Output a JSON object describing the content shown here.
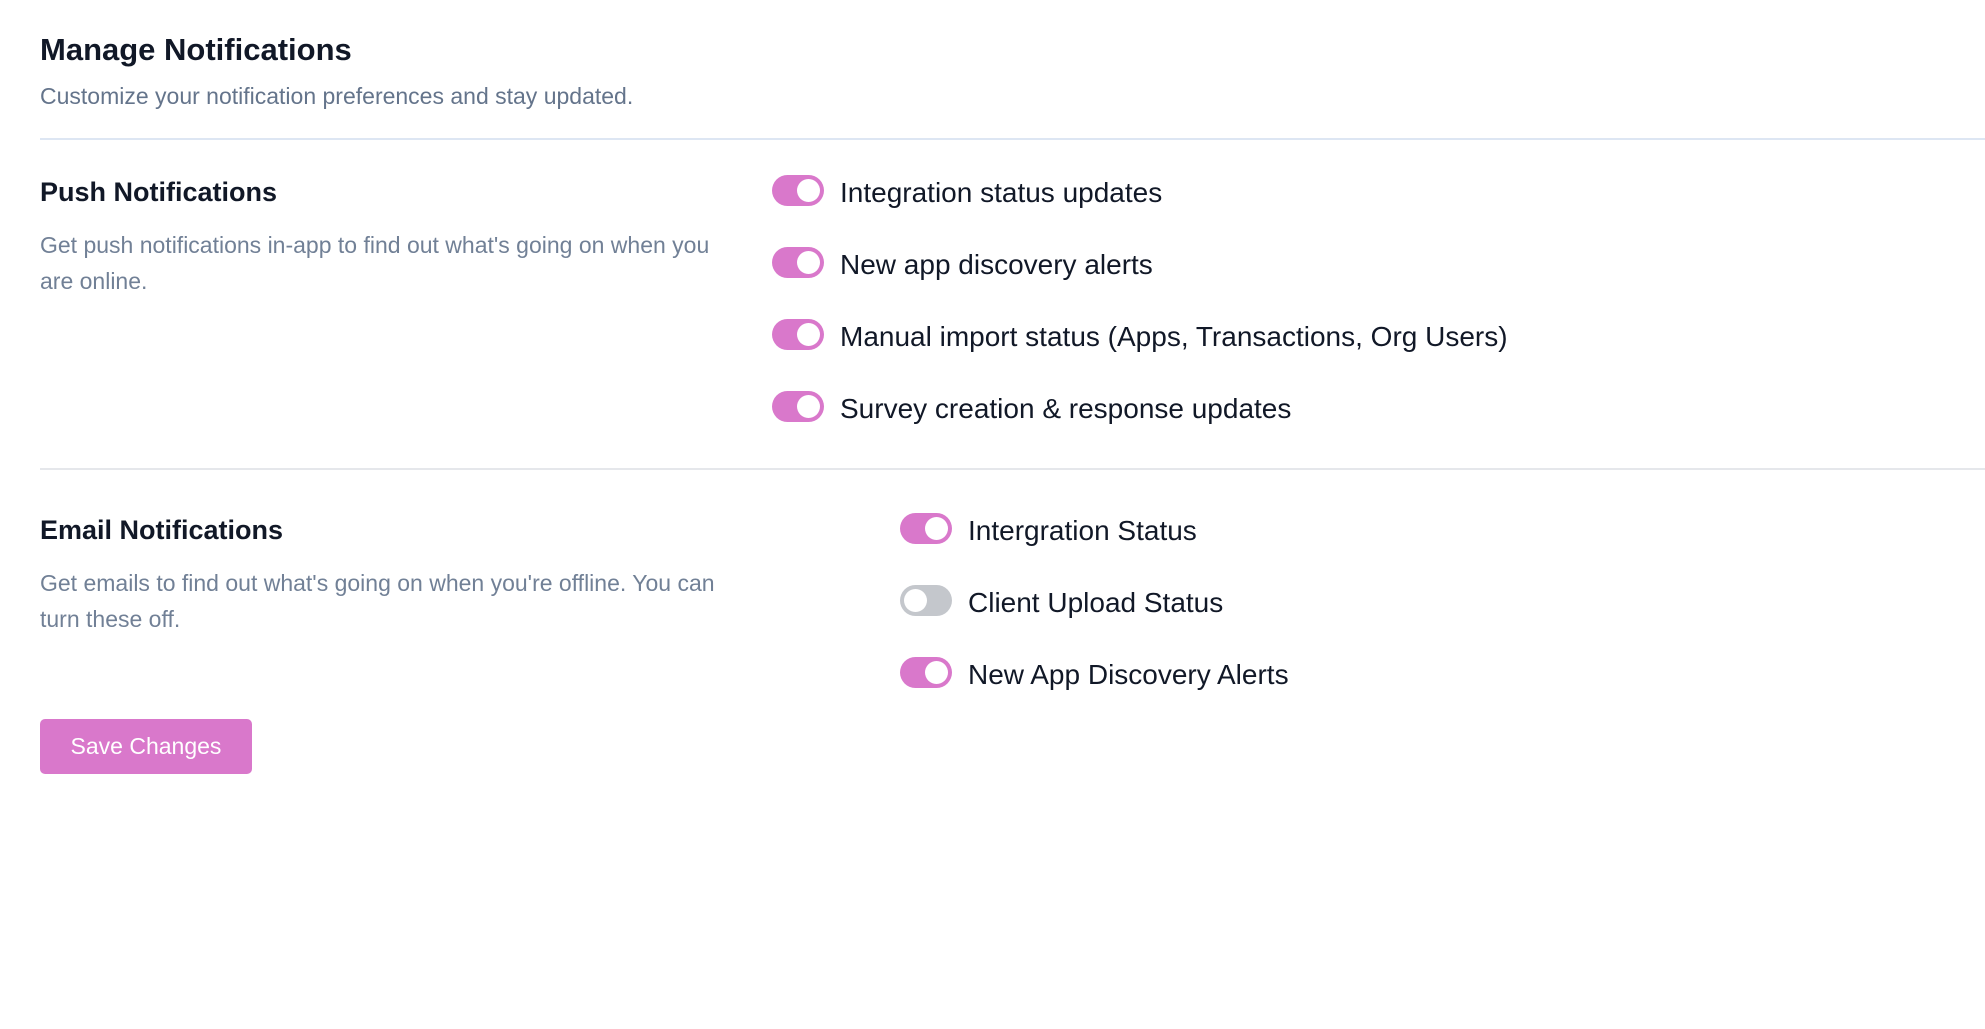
{
  "header": {
    "title": "Manage Notifications",
    "subtitle": "Customize your notification preferences and stay updated."
  },
  "push": {
    "title": "Push Notifications",
    "description": "Get push notifications in-app to find out what's going on when you are online.",
    "options": [
      {
        "label": "Integration status updates",
        "enabled": true
      },
      {
        "label": "New app discovery alerts",
        "enabled": true
      },
      {
        "label": "Manual import status (Apps, Transactions, Org Users)",
        "enabled": true
      },
      {
        "label": "Survey creation & response updates",
        "enabled": true
      }
    ]
  },
  "email": {
    "title": "Email Notifications",
    "description": "Get emails to find out what's going on when you're offline. You can turn these off.",
    "options": [
      {
        "label": "Intergration Status",
        "enabled": true
      },
      {
        "label": "Client Upload Status",
        "enabled": false
      },
      {
        "label": "New App Discovery Alerts",
        "enabled": true
      }
    ]
  },
  "actions": {
    "save_label": "Save Changes"
  },
  "colors": {
    "accent": "#d978cb",
    "toggle_off": "#c4c7cc",
    "muted_text": "#718096",
    "heading_text": "#111827"
  }
}
